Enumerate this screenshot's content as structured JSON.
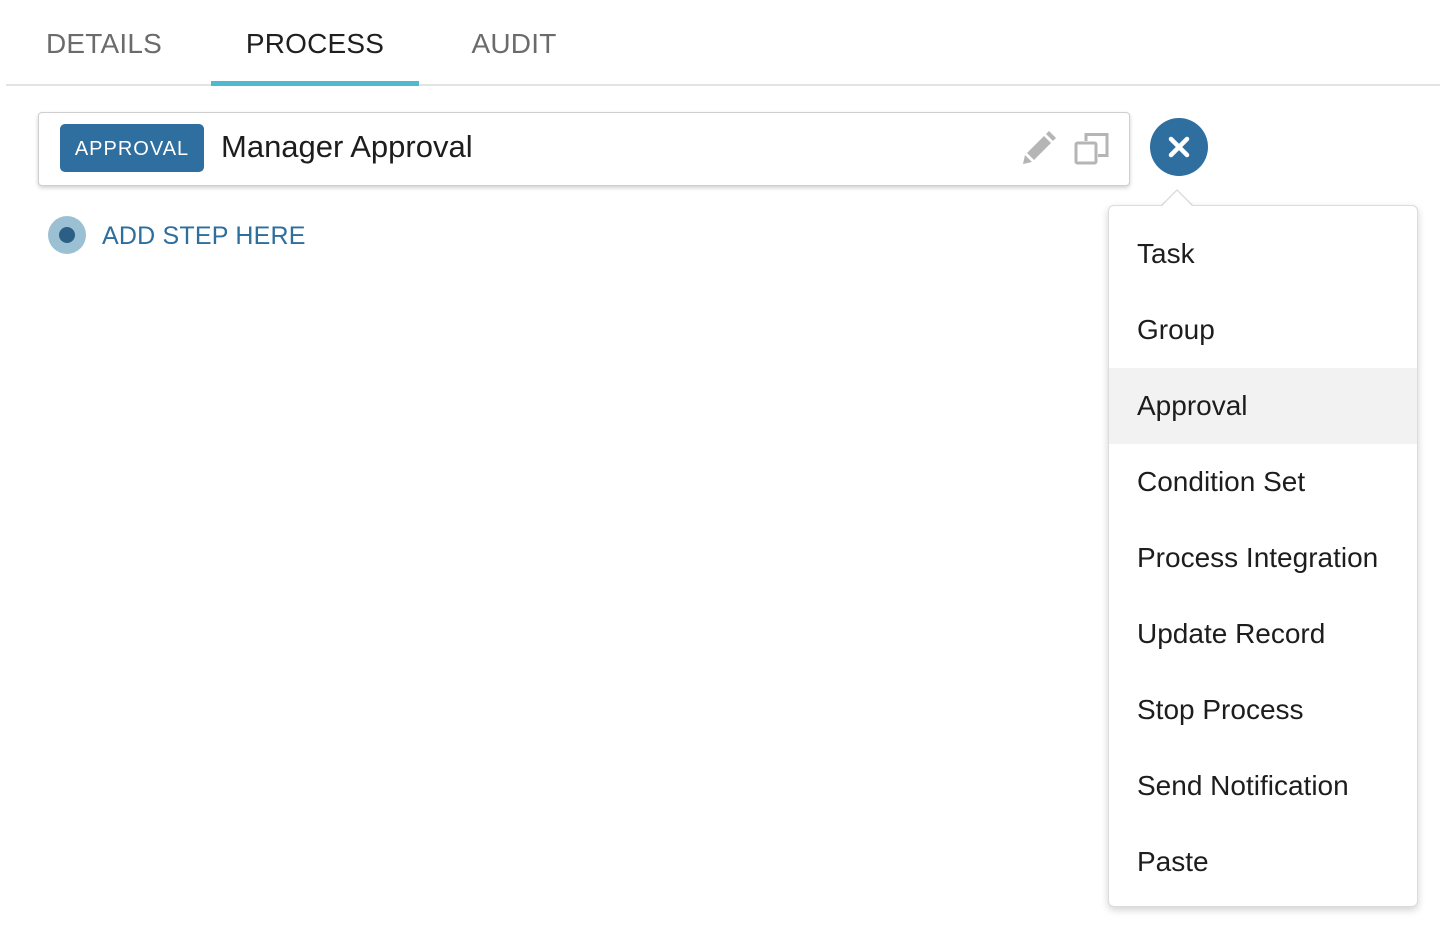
{
  "tabs": [
    {
      "label": "DETAILS",
      "active": false
    },
    {
      "label": "PROCESS",
      "active": true
    },
    {
      "label": "AUDIT",
      "active": false
    }
  ],
  "step": {
    "type_badge": "APPROVAL",
    "name": "Manager Approval",
    "edit_icon": "pencil-icon",
    "copy_icon": "duplicate-icon"
  },
  "add_step": {
    "label": "ADD STEP HERE"
  },
  "close_button": {
    "icon": "close-icon"
  },
  "menu": {
    "highlighted": "Approval",
    "items": [
      "Task",
      "Group",
      "Approval",
      "Condition Set",
      "Process Integration",
      "Update Record",
      "Stop Process",
      "Send Notification",
      "Paste"
    ]
  },
  "colors": {
    "accent": "#2f6f9f",
    "tab_underline": "#4fb9cf",
    "link": "#2c6e9e",
    "menu_hover": "#f2f2f2"
  }
}
